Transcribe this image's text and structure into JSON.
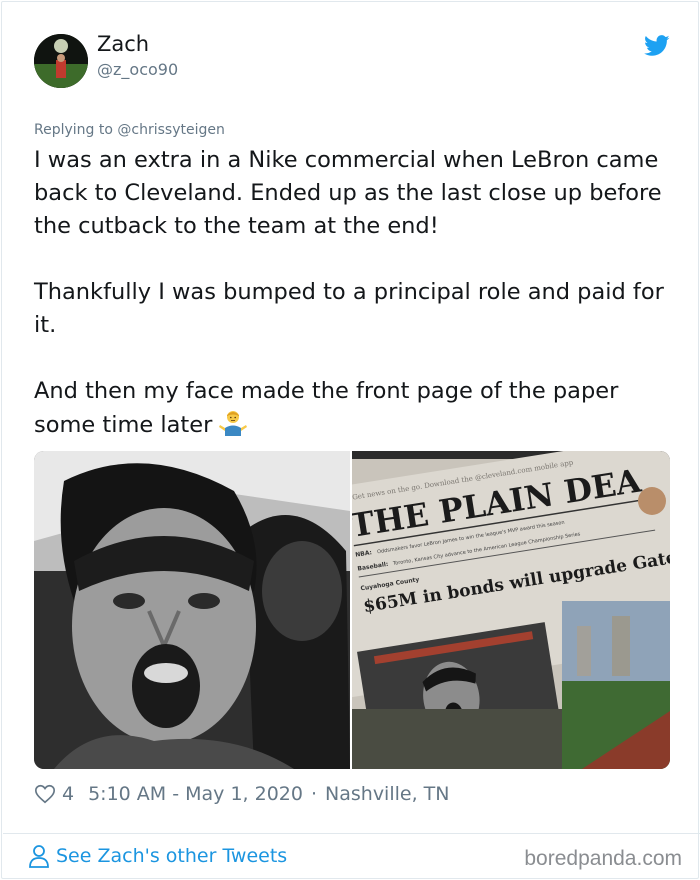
{
  "author": {
    "name": "Zach",
    "handle": "@z_oco90"
  },
  "reply": {
    "prefix": "Replying to ",
    "mention": "@chrissyteigen"
  },
  "tweet": {
    "paragraphs": [
      "I was an extra in a Nike commercial when LeBron came back to Cleveland. Ended up as the last close up before the cutback to the team at the end!",
      "Thankfully I was bumped to a principal role and paid for it.",
      "And then my face made the front page of the paper some time later"
    ],
    "emoji": "man-shrugging-emoji"
  },
  "media": {
    "left_photo": "screaming-fan-photo",
    "right_photo": {
      "masthead": "THE PLAIN DEA",
      "headline": "$65M in bonds will upgrade Gate",
      "kicker": "Cuyahoga County",
      "topline": "Get news on the go. Download the @cleveland.com mobile app",
      "brief_1_tag": "NBA:",
      "brief_1": "Oddsmakers favor LeBron James to win the league's MVP award this season",
      "brief_2_tag": "Baseball:",
      "brief_2": "Toronto, Kansas City advance to the American League Championship Series"
    }
  },
  "meta": {
    "likes": "4",
    "timestamp": "5:10 AM - May 1, 2020",
    "separator": "·",
    "location": "Nashville, TN"
  },
  "footer": {
    "see_more": "See Zach's other Tweets",
    "watermark": "boredpanda.com"
  },
  "colors": {
    "twitter_blue": "#1da1f2",
    "link_blue": "#1b95e0",
    "secondary_text": "#657786"
  }
}
